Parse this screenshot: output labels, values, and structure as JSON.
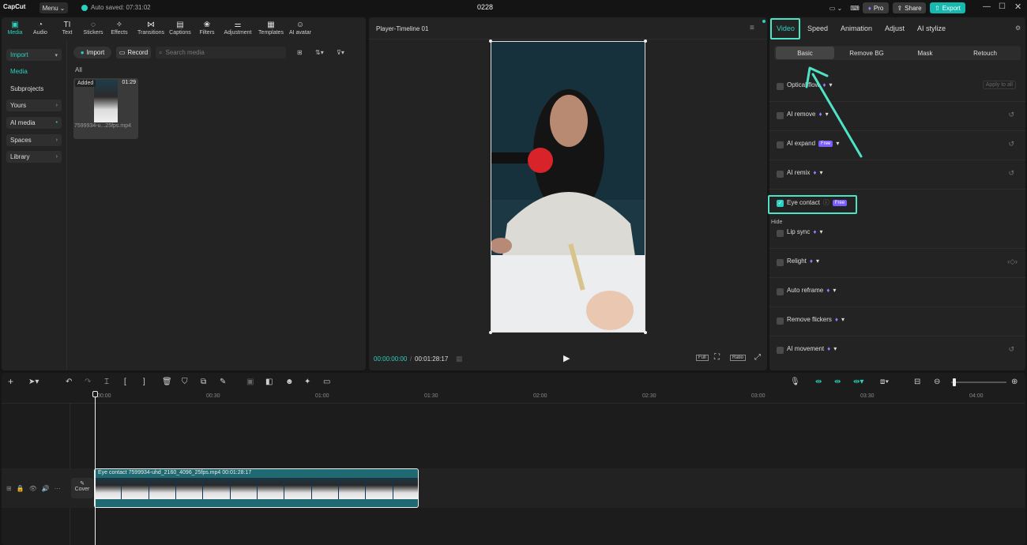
{
  "app": {
    "logo": "CapCut",
    "menu_label": "Menu",
    "autosave": "Auto saved: 07:31:02",
    "project_title": "0228",
    "pro_label": "Pro",
    "share_label": "Share",
    "export_label": "Export",
    "accent": "#2bd1c0"
  },
  "tools": [
    "Media",
    "Audio",
    "Text",
    "Stickers",
    "Effects",
    "Transitions",
    "Captions",
    "Filters",
    "Adjustment",
    "Templates",
    "AI avatar"
  ],
  "sidebar": {
    "import": "Import",
    "media": "Media",
    "subprojects": "Subprojects",
    "yours": "Yours",
    "ai_media": "AI media",
    "spaces": "Spaces",
    "library": "Library"
  },
  "media_bar": {
    "import_btn": "Import",
    "record_btn": "Record",
    "search_placeholder": "Search media",
    "filter_all": "All"
  },
  "media_item": {
    "badge": "Added",
    "duration": "01:29",
    "filename": "7599934-u...25fps.mp4"
  },
  "player": {
    "title": "Player-Timeline 01",
    "current_time": "00:00:00:00",
    "total_time": "00:01:28:17",
    "full_btn": "Full",
    "ratio_btn": "Ratio"
  },
  "inspector": {
    "tabs": [
      "Video",
      "Speed",
      "Animation",
      "Adjust",
      "AI stylize"
    ],
    "subtabs": [
      "Basic",
      "Remove BG",
      "Mask",
      "Retouch"
    ],
    "apply_all": "Apply to all",
    "features": [
      {
        "label": "Optical flow",
        "badge": ""
      },
      {
        "label": "AI remove",
        "badge": ""
      },
      {
        "label": "AI expand",
        "badge": "Free"
      },
      {
        "label": "AI remix",
        "badge": ""
      },
      {
        "label": "Eye contact",
        "badge": "Free"
      },
      {
        "label": "Lip sync",
        "badge": ""
      },
      {
        "label": "Relight",
        "badge": ""
      },
      {
        "label": "Auto reframe",
        "badge": ""
      },
      {
        "label": "Remove flickers",
        "badge": ""
      },
      {
        "label": "AI movement",
        "badge": ""
      }
    ],
    "hide_label": "Hide"
  },
  "timeline": {
    "ruler": [
      "00:00",
      "00:30",
      "01:00",
      "01:30",
      "02:00",
      "02:30",
      "03:00",
      "03:30",
      "04:00"
    ],
    "cover_label": "Cover",
    "clip_label": "Eye contact  7599934-uhd_2160_4096_25fps.mp4   00:01:28:17"
  }
}
